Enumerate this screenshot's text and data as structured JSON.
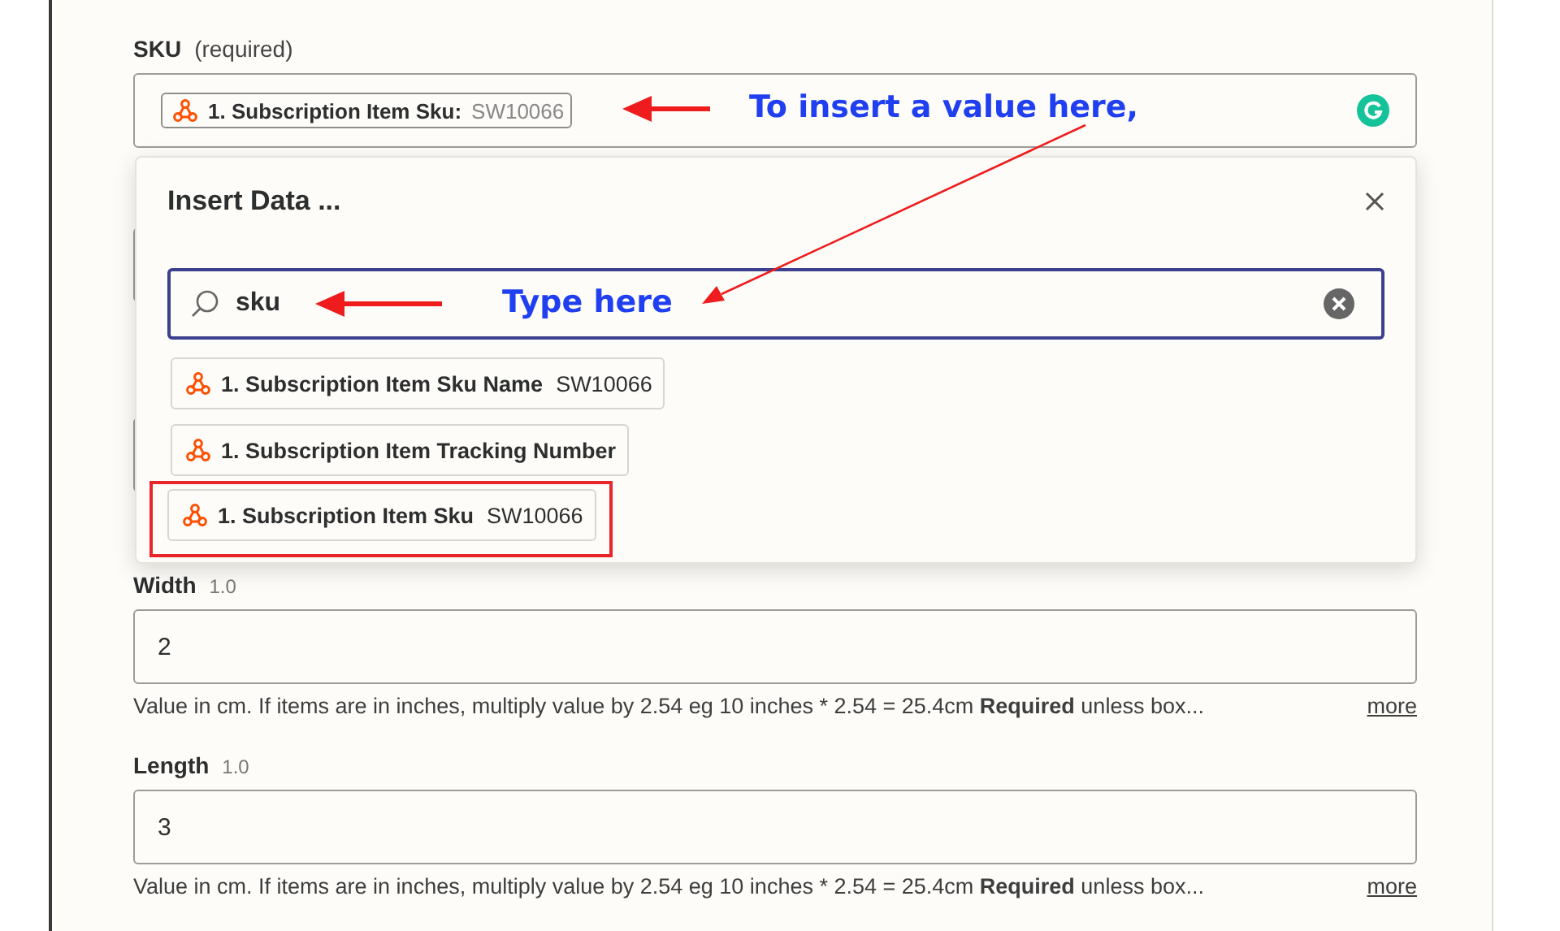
{
  "fields": [
    {
      "kind": "token",
      "label": "SKU",
      "note": "(required)",
      "token": {
        "label": "1. Subscription Item Sku:",
        "value": "SW10066"
      }
    },
    {
      "kind": "covered"
    },
    {
      "kind": "covered"
    },
    {
      "kind": "text",
      "label": "Width",
      "note": "1.0",
      "value": "2",
      "help": "Value in cm. If items are in inches, multiply value by 2.54 eg 10 inches * 2.54 = 25.4cm **Required** unless box...",
      "more": "more"
    },
    {
      "kind": "text",
      "label": "Length",
      "note": "1.0",
      "value": "3",
      "help": "Value in cm. If items are in inches, multiply value by 2.54 eg 10 inches * 2.54 = 25.4cm **Required** unless box...",
      "more": "more"
    }
  ],
  "popup": {
    "title": "Insert Data ...",
    "search": {
      "value": "sku"
    },
    "items": [
      {
        "label": "1. Subscription Item Sku Name",
        "value": "SW10066",
        "highlighted": false
      },
      {
        "label": "1. Subscription Item Tracking Number",
        "highlighted": false
      },
      {
        "label": "1. Subscription Item Sku",
        "value": "SW10066",
        "highlighted": true
      }
    ]
  },
  "annotations": [
    {
      "text": "To insert a value here,"
    },
    {
      "text": "Type here"
    }
  ]
}
